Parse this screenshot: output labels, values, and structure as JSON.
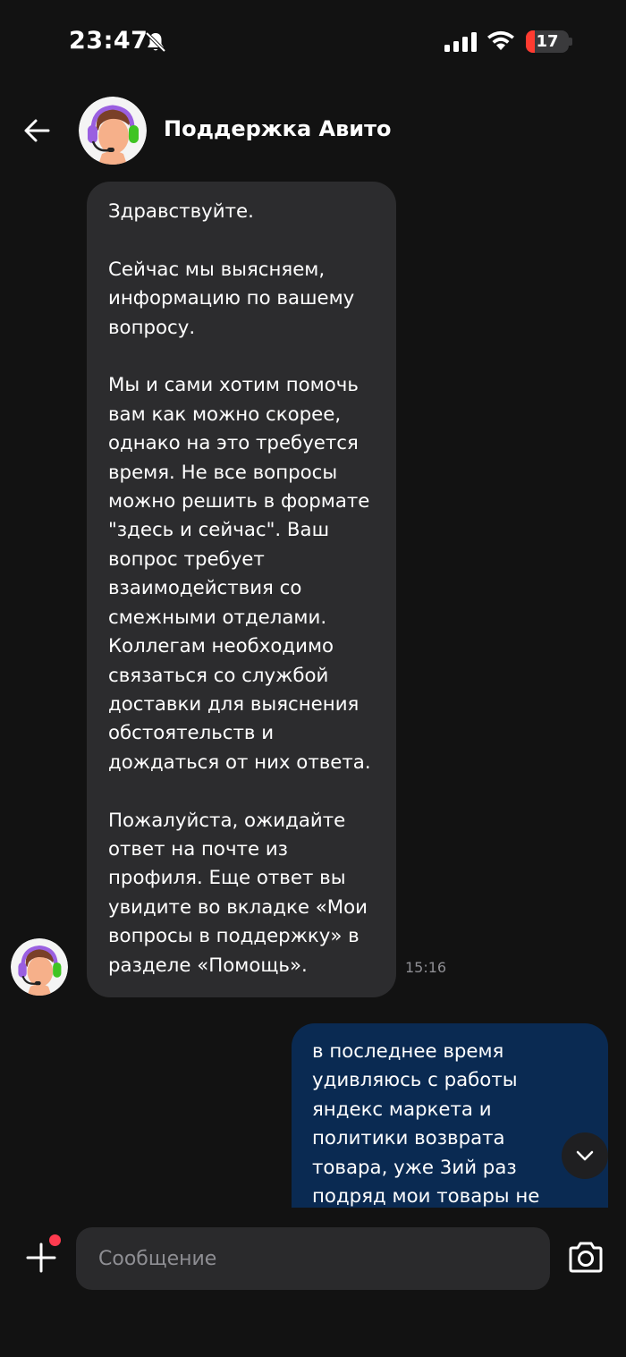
{
  "status_bar": {
    "time": "23:47",
    "battery_level": "17"
  },
  "header": {
    "title": "Поддержка Авито"
  },
  "messages": [
    {
      "direction": "incoming",
      "text": "Здравствуйте.\n\nСейчас мы выясняем,\nинформацию по вашему\nвопросу.\n\nМы и сами хотим помочь\nвам как можно скорее,\nоднако на это требуется\nвремя. Не все вопросы\nможно решить в формате\n\"здесь и сейчас\". Ваш\nвопрос требует\nвзаимодействия со\nсмежными отделами.\nКоллегам необходимо\nсвязаться со службой\nдоставки для выяснения\nобстоятельств и\nдождаться от них ответа.\n\nПожалуйста, ожидайте\nответ на почте из\nпрофиля. Еще ответ вы\nувидите во вкладке «Мои\nвопросы в поддержку» в\nразделе «Помощь».",
      "time": "15:16"
    },
    {
      "direction": "outgoing",
      "text": "в последнее время\nудивляюсь с работы\nяндекс маркета и\nполитики возврата\nтовара, уже 3ий раз\nподряд мои товары не"
    }
  ],
  "composer": {
    "placeholder": "Сообщение"
  },
  "icons": {
    "back": "arrow-left-icon",
    "attach": "plus-icon",
    "camera": "camera-icon",
    "scroll": "chevron-down-icon"
  },
  "colors": {
    "background": "#121212",
    "incoming_bubble": "#2c2c2e",
    "outgoing_bubble": "#0a2a52",
    "notification_dot": "#ff3b4f"
  }
}
